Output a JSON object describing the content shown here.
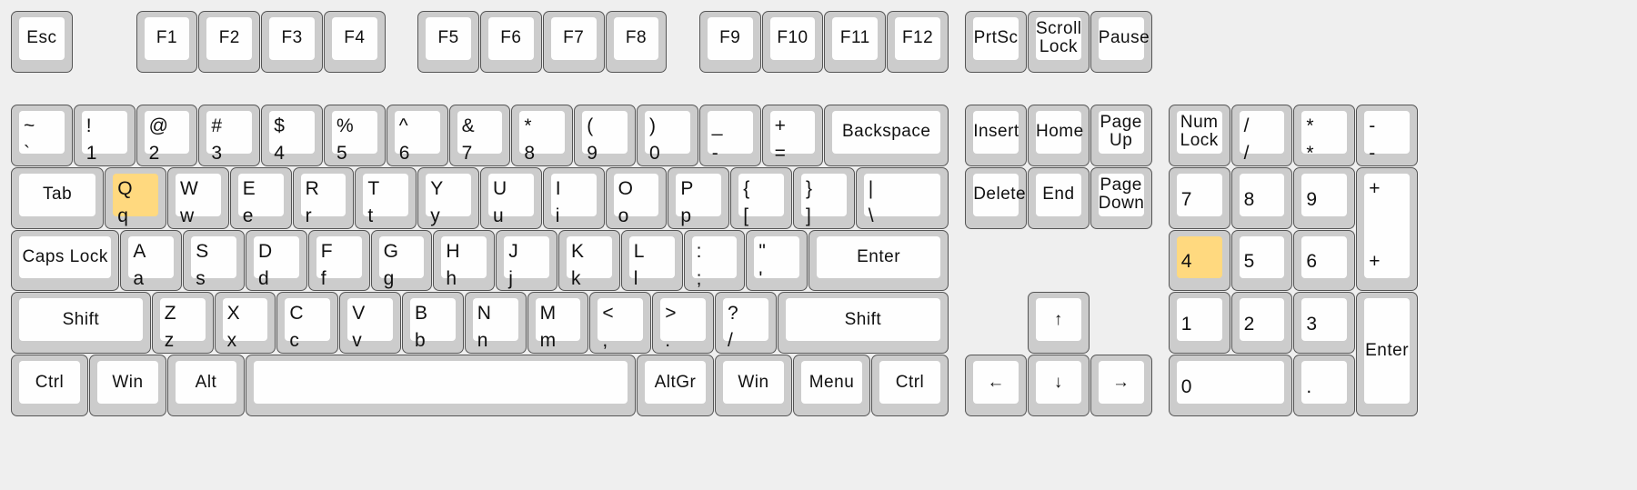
{
  "highlight_color": "#ffd97f",
  "keys": [
    {
      "id": "esc",
      "center": "Esc"
    },
    {
      "id": "f1",
      "center": "F1"
    },
    {
      "id": "f2",
      "center": "F2"
    },
    {
      "id": "f3",
      "center": "F3"
    },
    {
      "id": "f4",
      "center": "F4"
    },
    {
      "id": "f5",
      "center": "F5"
    },
    {
      "id": "f6",
      "center": "F6"
    },
    {
      "id": "f7",
      "center": "F7"
    },
    {
      "id": "f8",
      "center": "F8"
    },
    {
      "id": "f9",
      "center": "F9"
    },
    {
      "id": "f10",
      "center": "F10"
    },
    {
      "id": "f11",
      "center": "F11"
    },
    {
      "id": "f12",
      "center": "F12"
    },
    {
      "id": "prtsc",
      "center": "PrtSc"
    },
    {
      "id": "scroll",
      "center": "Scroll\nLock"
    },
    {
      "id": "pause",
      "center": "Pause"
    },
    {
      "id": "grave",
      "top": "~",
      "bottom": "`"
    },
    {
      "id": "1",
      "top": "!",
      "bottom": "1"
    },
    {
      "id": "2",
      "top": "@",
      "bottom": "2"
    },
    {
      "id": "3",
      "top": "#",
      "bottom": "3"
    },
    {
      "id": "4",
      "top": "$",
      "bottom": "4"
    },
    {
      "id": "5",
      "top": "%",
      "bottom": "5"
    },
    {
      "id": "6",
      "top": "^",
      "bottom": "6"
    },
    {
      "id": "7",
      "top": "&",
      "bottom": "7"
    },
    {
      "id": "8",
      "top": "*",
      "bottom": "8"
    },
    {
      "id": "9",
      "top": "(",
      "bottom": "9"
    },
    {
      "id": "0",
      "top": ")",
      "bottom": "0"
    },
    {
      "id": "minus",
      "top": "_",
      "bottom": "-"
    },
    {
      "id": "equal",
      "top": "+",
      "bottom": "="
    },
    {
      "id": "backspace",
      "center": "Backspace"
    },
    {
      "id": "insert",
      "center": "Insert"
    },
    {
      "id": "home",
      "center": "Home"
    },
    {
      "id": "pgup",
      "center": "Page\nUp"
    },
    {
      "id": "numlock",
      "center": "Num\nLock"
    },
    {
      "id": "kpdiv",
      "top": "/",
      "bottom": "/"
    },
    {
      "id": "kpmul",
      "top": "*",
      "bottom": "*"
    },
    {
      "id": "kpsub",
      "top": "-",
      "bottom": "-"
    },
    {
      "id": "tab",
      "center": "Tab"
    },
    {
      "id": "q",
      "top": "Q",
      "bottom": "q",
      "highlighted": true
    },
    {
      "id": "w",
      "top": "W",
      "bottom": "w"
    },
    {
      "id": "e",
      "top": "E",
      "bottom": "e"
    },
    {
      "id": "r",
      "top": "R",
      "bottom": "r"
    },
    {
      "id": "t",
      "top": "T",
      "bottom": "t"
    },
    {
      "id": "y",
      "top": "Y",
      "bottom": "y"
    },
    {
      "id": "u",
      "top": "U",
      "bottom": "u"
    },
    {
      "id": "i",
      "top": "I",
      "bottom": "i"
    },
    {
      "id": "o",
      "top": "O",
      "bottom": "o"
    },
    {
      "id": "p",
      "top": "P",
      "bottom": "p"
    },
    {
      "id": "lbracket",
      "top": "{",
      "bottom": "["
    },
    {
      "id": "rbracket",
      "top": "}",
      "bottom": "]"
    },
    {
      "id": "backslash",
      "top": "|",
      "bottom": "\\"
    },
    {
      "id": "delete",
      "center": "Delete"
    },
    {
      "id": "end",
      "center": "End"
    },
    {
      "id": "pgdn",
      "center": "Page\nDown"
    },
    {
      "id": "kp7",
      "bl": "7"
    },
    {
      "id": "kp8",
      "bl": "8"
    },
    {
      "id": "kp9",
      "bl": "9"
    },
    {
      "id": "kpadd",
      "top": "+",
      "bl": "+"
    },
    {
      "id": "caps",
      "center": "Caps Lock"
    },
    {
      "id": "a",
      "top": "A",
      "bottom": "a"
    },
    {
      "id": "s",
      "top": "S",
      "bottom": "s"
    },
    {
      "id": "d",
      "top": "D",
      "bottom": "d"
    },
    {
      "id": "f",
      "top": "F",
      "bottom": "f"
    },
    {
      "id": "g",
      "top": "G",
      "bottom": "g"
    },
    {
      "id": "h",
      "top": "H",
      "bottom": "h"
    },
    {
      "id": "j",
      "top": "J",
      "bottom": "j"
    },
    {
      "id": "k",
      "top": "K",
      "bottom": "k"
    },
    {
      "id": "l",
      "top": "L",
      "bottom": "l"
    },
    {
      "id": "semicolon",
      "top": ":",
      "bottom": ";"
    },
    {
      "id": "quote",
      "top": "\"",
      "bottom": "'"
    },
    {
      "id": "enter",
      "center": "Enter"
    },
    {
      "id": "kp4",
      "bl": "4",
      "highlighted": true
    },
    {
      "id": "kp5",
      "bl": "5"
    },
    {
      "id": "kp6",
      "bl": "6"
    },
    {
      "id": "lshift",
      "center": "Shift"
    },
    {
      "id": "z",
      "top": "Z",
      "bottom": "z"
    },
    {
      "id": "x",
      "top": "X",
      "bottom": "x"
    },
    {
      "id": "c",
      "top": "C",
      "bottom": "c"
    },
    {
      "id": "v",
      "top": "V",
      "bottom": "v"
    },
    {
      "id": "b",
      "top": "B",
      "bottom": "b"
    },
    {
      "id": "n",
      "top": "N",
      "bottom": "n"
    },
    {
      "id": "m",
      "top": "M",
      "bottom": "m"
    },
    {
      "id": "comma",
      "top": "<",
      "bottom": ","
    },
    {
      "id": "period",
      "top": ">",
      "bottom": "."
    },
    {
      "id": "slash",
      "top": "?",
      "bottom": "/"
    },
    {
      "id": "rshift",
      "center": "Shift"
    },
    {
      "id": "up",
      "center": "↑"
    },
    {
      "id": "kp1",
      "bl": "1"
    },
    {
      "id": "kp2",
      "bl": "2"
    },
    {
      "id": "kp3",
      "bl": "3"
    },
    {
      "id": "kpenter",
      "center": "Enter"
    },
    {
      "id": "lctrl",
      "center": "Ctrl"
    },
    {
      "id": "lwin",
      "center": "Win"
    },
    {
      "id": "lalt",
      "center": "Alt"
    },
    {
      "id": "space"
    },
    {
      "id": "altgr",
      "center": "AltGr"
    },
    {
      "id": "rwin",
      "center": "Win"
    },
    {
      "id": "menu",
      "center": "Menu"
    },
    {
      "id": "rctrl",
      "center": "Ctrl"
    },
    {
      "id": "left",
      "center": "←"
    },
    {
      "id": "down",
      "center": "↓"
    },
    {
      "id": "right",
      "center": "→"
    },
    {
      "id": "kp0",
      "bl": "0"
    },
    {
      "id": "kpdot",
      "bl": "."
    }
  ]
}
